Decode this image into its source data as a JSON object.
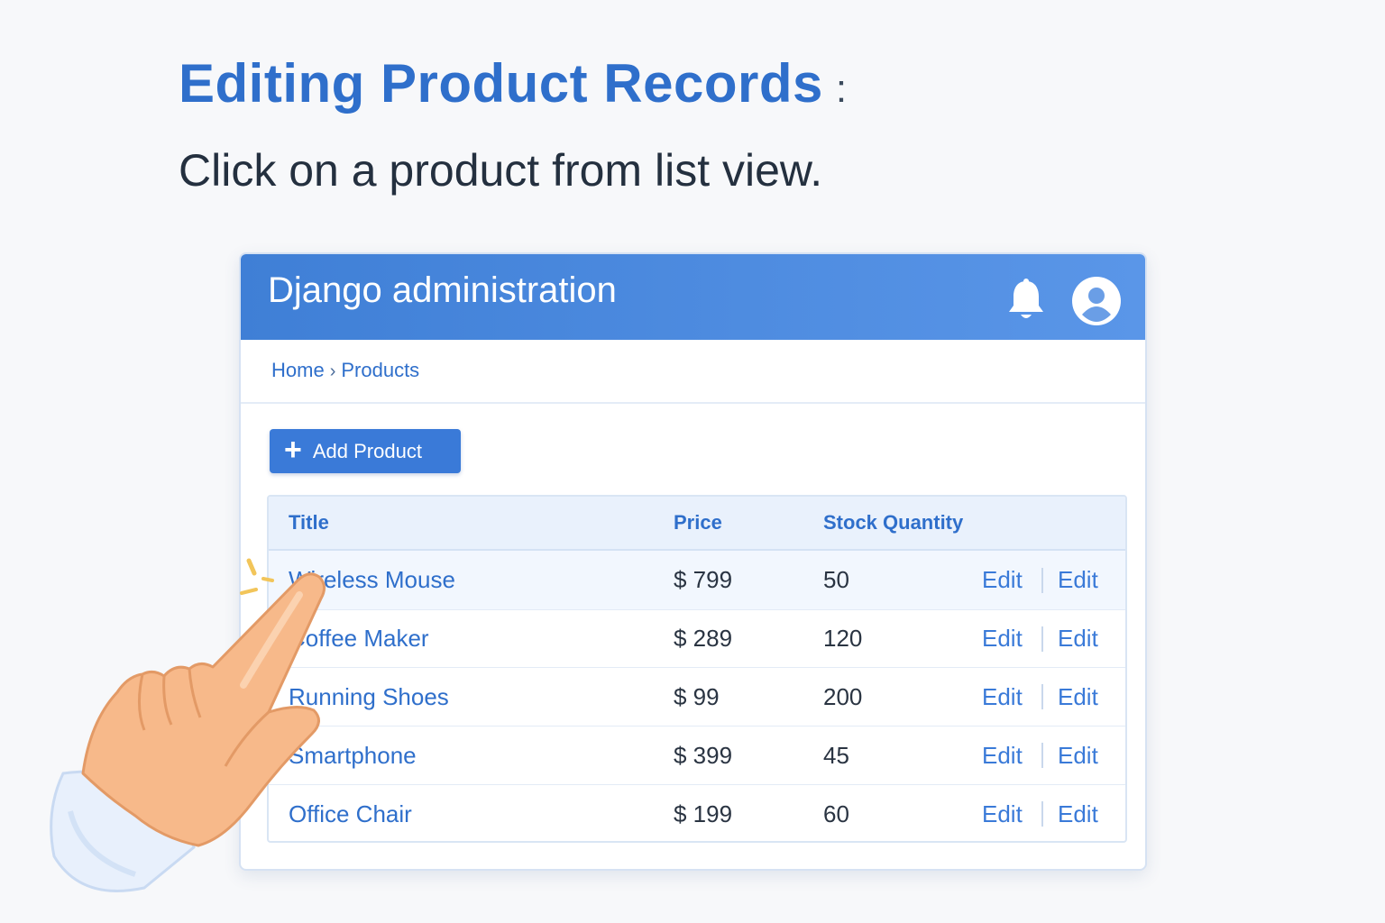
{
  "slide": {
    "title": "Editing Product Records",
    "title_suffix": ":",
    "subtitle": "Click on a product from list view."
  },
  "window": {
    "title": "Django administration",
    "icons": {
      "notifications": "bell-icon",
      "account": "user-avatar-icon"
    },
    "breadcrumb": {
      "home": "Home",
      "separator": "›",
      "current": "Products"
    },
    "add_button": {
      "icon": "+",
      "label": "Add Product"
    },
    "table": {
      "columns": {
        "title": "Title",
        "price": "Price",
        "stock": "Stock Quantity"
      },
      "rows": [
        {
          "title": "Wireless Mouse",
          "price": "$ 799",
          "stock": "50",
          "action1": "Edit",
          "action2": "Edit"
        },
        {
          "title": "Coffee Maker",
          "price": "$ 289",
          "stock": "120",
          "action1": "Edit",
          "action2": "Edit"
        },
        {
          "title": "Running Shoes",
          "price": "$ 99",
          "stock": "200",
          "action1": "Edit",
          "action2": "Edit"
        },
        {
          "title": "Smartphone",
          "price": "$ 399",
          "stock": "45",
          "action1": "Edit",
          "action2": "Edit"
        },
        {
          "title": "Office Chair",
          "price": "$ 199",
          "stock": "60",
          "action1": "Edit",
          "action2": "Edit"
        }
      ]
    }
  },
  "colors": {
    "accent": "#2f6fcb",
    "header_start": "#3f7fd6",
    "header_end": "#5a96e8",
    "button": "#3a7ad8"
  },
  "illustration": {
    "pointer": "pointing-hand-icon"
  }
}
